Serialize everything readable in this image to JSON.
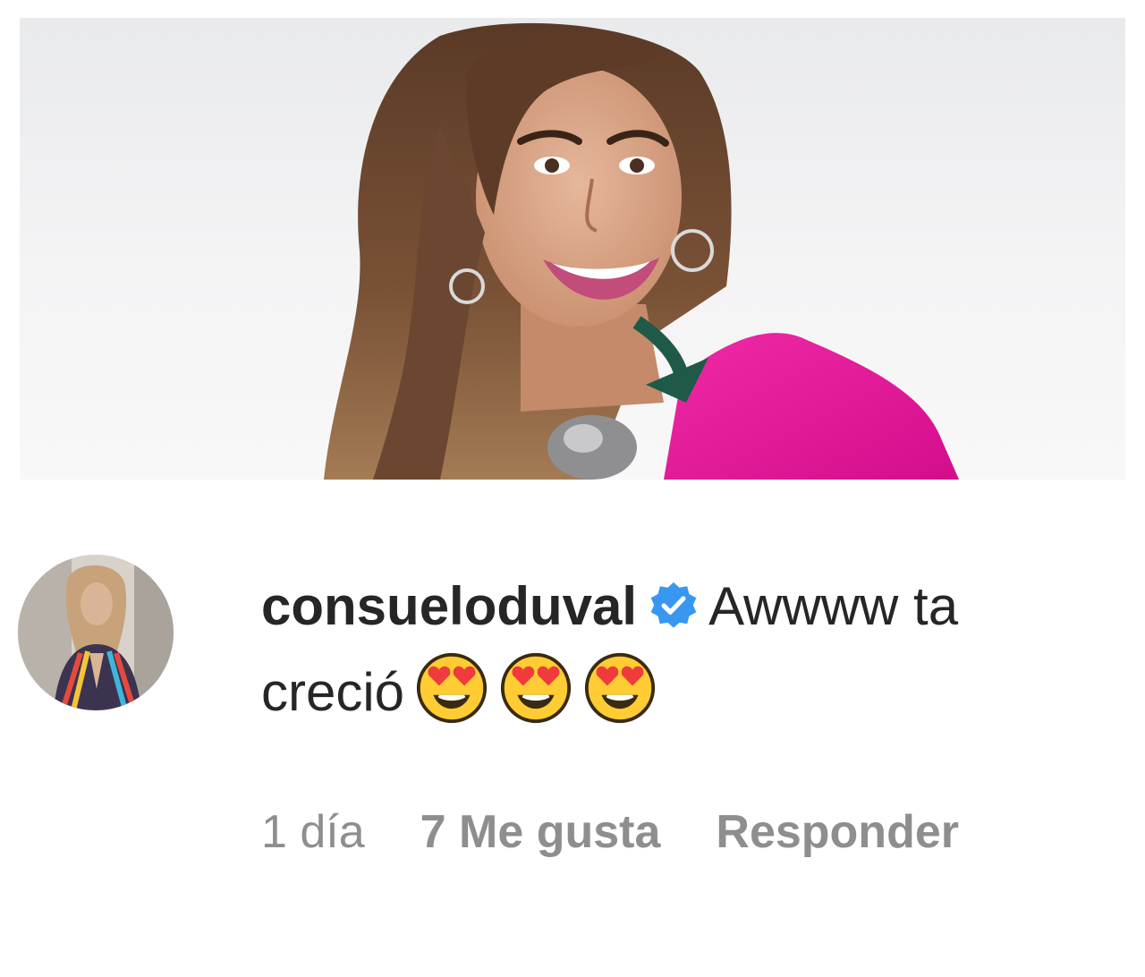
{
  "post": {
    "photo_description": "smiling woman with long wavy brown hair in magenta top"
  },
  "comment": {
    "username": "consueloduval",
    "verified_icon": "verified-badge-icon",
    "text_line1": "Awwww ta",
    "text_line2": "creció",
    "emojis": [
      "😍",
      "😍",
      "😍"
    ],
    "time": "1 día",
    "likes": "7 Me gusta",
    "reply_label": "Responder"
  },
  "colors": {
    "text": "#262626",
    "meta": "#8e8e8e",
    "verified": "#3897f0",
    "magenta": "#e5159a"
  }
}
